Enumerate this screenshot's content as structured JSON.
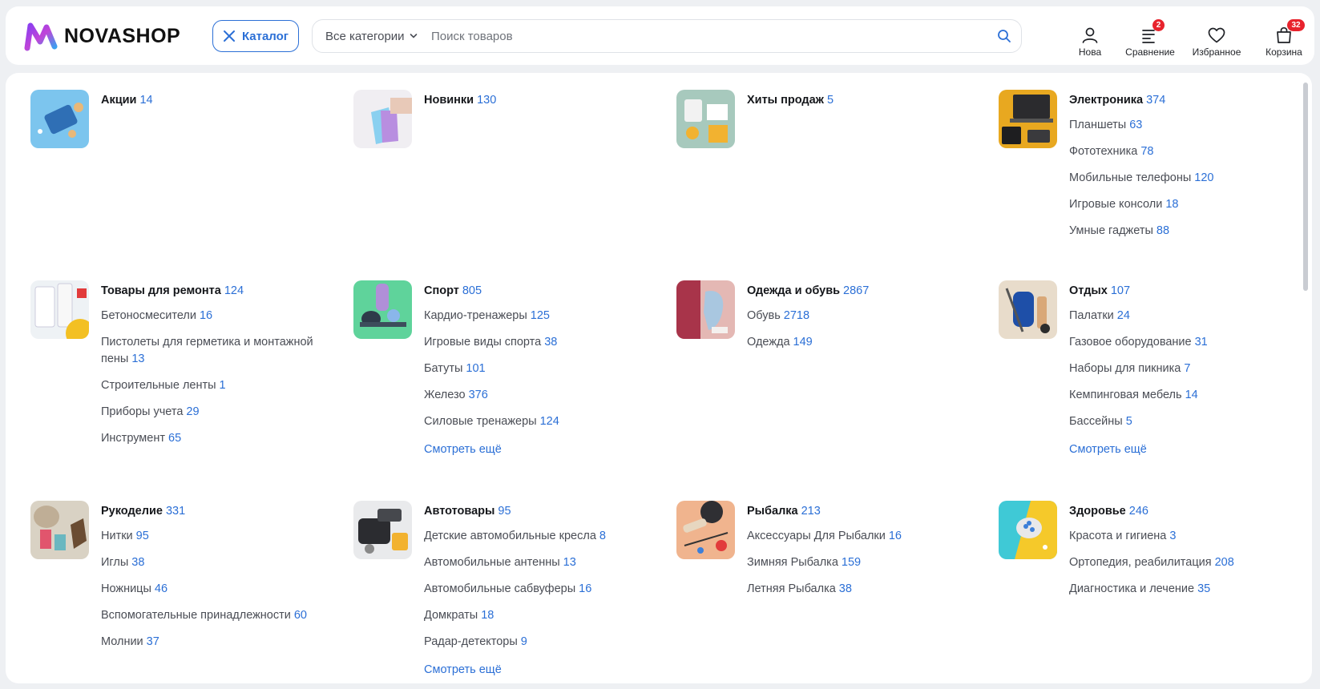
{
  "header": {
    "logo_text": "NOVASHOP",
    "catalog_label": "Каталог",
    "category_select": "Все категории",
    "search_placeholder": "Поиск товаров",
    "actions": {
      "profile": "Нова",
      "compare": "Сравнение",
      "compare_badge": "2",
      "favorites": "Избранное",
      "cart": "Корзина",
      "cart_badge": "32"
    }
  },
  "colors": {
    "accent": "#2b6fd6",
    "badge": "#e8232d",
    "text": "#15171b",
    "muted": "#4a4d55"
  },
  "categories": [
    {
      "title": "Акции",
      "count": "14",
      "image": "promo-image",
      "subs": []
    },
    {
      "title": "Новинки",
      "count": "130",
      "image": "shopping-bags-image",
      "subs": []
    },
    {
      "title": "Хиты продаж",
      "count": "5",
      "image": "bestsellers-image",
      "subs": []
    },
    {
      "title": "Электроника",
      "count": "374",
      "image": "electronics-image",
      "subs": [
        {
          "label": "Планшеты",
          "count": "63"
        },
        {
          "label": "Фототехника",
          "count": "78"
        },
        {
          "label": "Мобильные телефоны",
          "count": "120"
        },
        {
          "label": "Игровые консоли",
          "count": "18"
        },
        {
          "label": "Умные гаджеты",
          "count": "88"
        }
      ]
    },
    {
      "title": "Товары для ремонта",
      "count": "124",
      "image": "repair-image",
      "subs": [
        {
          "label": "Бетоносмесители",
          "count": "16"
        },
        {
          "label": "Пистолеты для герметика и монтажной пены",
          "count": "13"
        },
        {
          "label": "Строительные ленты",
          "count": "1"
        },
        {
          "label": "Приборы учета",
          "count": "29"
        },
        {
          "label": "Инструмент",
          "count": "65"
        }
      ]
    },
    {
      "title": "Спорт",
      "count": "805",
      "image": "sport-image",
      "subs": [
        {
          "label": "Кардио-тренажеры",
          "count": "125"
        },
        {
          "label": "Игровые виды спорта",
          "count": "38"
        },
        {
          "label": "Батуты",
          "count": "101"
        },
        {
          "label": "Железо",
          "count": "376"
        },
        {
          "label": "Силовые тренажеры",
          "count": "124"
        }
      ],
      "more": "Смотреть ещё"
    },
    {
      "title": "Одежда и обувь",
      "count": "2867",
      "image": "clothes-image",
      "subs": [
        {
          "label": "Обувь",
          "count": "2718"
        },
        {
          "label": "Одежда",
          "count": "149"
        }
      ]
    },
    {
      "title": "Отдых",
      "count": "107",
      "image": "outdoor-image",
      "subs": [
        {
          "label": "Палатки",
          "count": "24"
        },
        {
          "label": "Газовое оборудование",
          "count": "31"
        },
        {
          "label": "Наборы для пикника",
          "count": "7"
        },
        {
          "label": "Кемпинговая мебель",
          "count": "14"
        },
        {
          "label": "Бассейны",
          "count": "5"
        }
      ],
      "more": "Смотреть ещё"
    },
    {
      "title": "Рукоделие",
      "count": "331",
      "image": "crafts-image",
      "subs": [
        {
          "label": "Нитки",
          "count": "95"
        },
        {
          "label": "Иглы",
          "count": "38"
        },
        {
          "label": "Ножницы",
          "count": "46"
        },
        {
          "label": "Вспомогательные принадлежности",
          "count": "60"
        },
        {
          "label": "Молнии",
          "count": "37"
        }
      ]
    },
    {
      "title": "Автотовары",
      "count": "95",
      "image": "auto-image",
      "subs": [
        {
          "label": "Детские автомобильные кресла",
          "count": "8"
        },
        {
          "label": "Автомобильные антенны",
          "count": "13"
        },
        {
          "label": "Автомобильные сабвуферы",
          "count": "16"
        },
        {
          "label": "Домкраты",
          "count": "18"
        },
        {
          "label": "Радар-детекторы",
          "count": "9"
        }
      ],
      "more": "Смотреть ещё"
    },
    {
      "title": "Рыбалка",
      "count": "213",
      "image": "fishing-image",
      "subs": [
        {
          "label": "Аксессуары Для Рыбалки",
          "count": "16"
        },
        {
          "label": "Зимняя Рыбалка",
          "count": "159"
        },
        {
          "label": "Летняя Рыбалка",
          "count": "38"
        }
      ]
    },
    {
      "title": "Здоровье",
      "count": "246",
      "image": "health-image",
      "subs": [
        {
          "label": "Красота и гигиена",
          "count": "3"
        },
        {
          "label": "Ортопедия, реабилитация",
          "count": "208"
        },
        {
          "label": "Диагностика и лечение",
          "count": "35"
        }
      ]
    }
  ]
}
